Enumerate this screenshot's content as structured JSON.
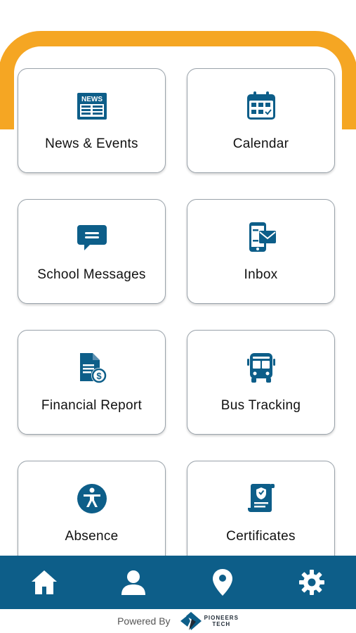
{
  "header": {
    "accent_color": "#f5a623"
  },
  "cards": [
    {
      "label": "News & Events",
      "icon": "news-icon"
    },
    {
      "label": "Calendar",
      "icon": "calendar-icon"
    },
    {
      "label": "School Messages",
      "icon": "chat-icon"
    },
    {
      "label": "Inbox",
      "icon": "inbox-icon"
    },
    {
      "label": "Financial Report",
      "icon": "financial-report-icon"
    },
    {
      "label": "Bus Tracking",
      "icon": "bus-icon"
    },
    {
      "label": "Absence",
      "icon": "absence-icon"
    },
    {
      "label": "Certificates",
      "icon": "certificate-icon"
    }
  ],
  "news_icon_text": "NEWS",
  "bottom_nav": {
    "color": "#0d5e89",
    "items": [
      {
        "icon": "home-icon"
      },
      {
        "icon": "user-icon"
      },
      {
        "icon": "location-icon"
      },
      {
        "icon": "settings-icon"
      }
    ]
  },
  "footer": {
    "powered_by": "Powered By",
    "brand_line1": "PIONEERS",
    "brand_line2": "TECH"
  },
  "colors": {
    "icon_blue": "#0d5e89"
  }
}
